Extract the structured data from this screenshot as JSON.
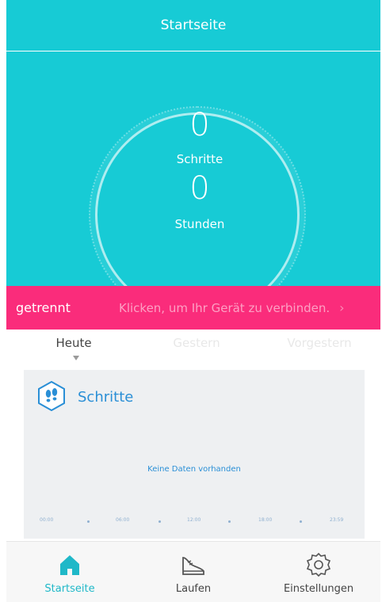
{
  "header": {
    "title": "Startseite"
  },
  "dashboard": {
    "steps_value": "0",
    "steps_label": "Schritte",
    "hours_value": "0",
    "hours_label": "Stunden"
  },
  "connection": {
    "status": "getrennt",
    "action": "Klicken, um Ihr Gerät zu verbinden.",
    "chevron": "›"
  },
  "day_tabs": [
    {
      "label": "Heute",
      "active": true
    },
    {
      "label": "Gestern",
      "active": false
    },
    {
      "label": "Vorgestern",
      "active": false
    }
  ],
  "steps_card": {
    "title": "Schritte",
    "empty_message": "Keine Daten vorhanden",
    "time_axis": [
      "00:00",
      "06:00",
      "12:00",
      "18:00",
      "23:59"
    ]
  },
  "bottom_nav": [
    {
      "label": "Startseite",
      "icon": "home-icon",
      "active": true
    },
    {
      "label": "Laufen",
      "icon": "shoe-icon",
      "active": false
    },
    {
      "label": "Einstellungen",
      "icon": "gear-icon",
      "active": false
    }
  ],
  "colors": {
    "primary": "#17cbd5",
    "alert": "#fa2c7b",
    "accent_blue": "#2a8fd6",
    "nav_active": "#1fb8c8"
  }
}
